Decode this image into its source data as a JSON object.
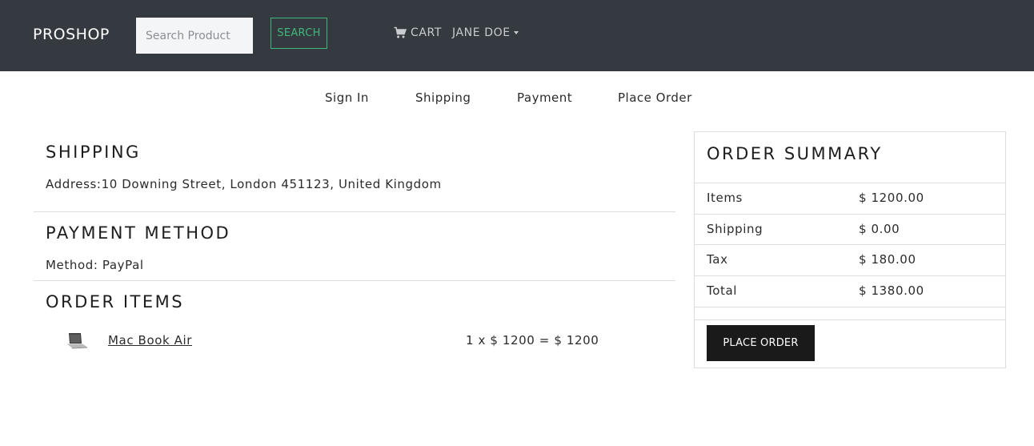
{
  "header": {
    "brand": "PROSHOP",
    "search": {
      "placeholder": "Search Product",
      "button_label": "SEARCH"
    },
    "cart_label": "CART",
    "cart_icon": "cart-icon",
    "user_label": "JANE DOE"
  },
  "steps": [
    "Sign In",
    "Shipping",
    "Payment",
    "Place Order"
  ],
  "shipping": {
    "heading": "SHIPPING",
    "address": "Address:10 Downing Street, London 451123, United Kingdom"
  },
  "payment": {
    "heading": "PAYMENT METHOD",
    "method": "Method: PayPal"
  },
  "order_items": {
    "heading": "ORDER ITEMS",
    "items": [
      {
        "name": "Mac Book Air",
        "price_line": "1 x $ 1200 = $ 1200",
        "image_icon": "laptop-thumbnail"
      }
    ]
  },
  "summary": {
    "title": "ORDER SUMMARY",
    "rows": [
      {
        "label": "Items",
        "value": "$ 1200.00"
      },
      {
        "label": "Shipping",
        "value": "$ 0.00"
      },
      {
        "label": "Tax",
        "value": "$ 180.00"
      },
      {
        "label": "Total",
        "value": "$ 1380.00"
      }
    ],
    "button_label": "PLACE ORDER"
  },
  "colors": {
    "header_bg": "#343a40",
    "search_accent": "#3fb77a",
    "button_dark": "#1a1a1a"
  }
}
